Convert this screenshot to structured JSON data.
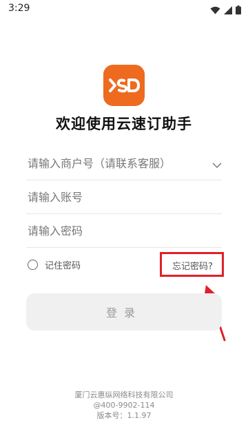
{
  "status_bar": {
    "time": "3:29",
    "icons": [
      "wifi-icon",
      "signal-icon",
      "battery-icon"
    ]
  },
  "app": {
    "logo_icon": "ysd-logo",
    "brand_color": "#ee6a1f",
    "welcome_title": "欢迎使用云速订助手"
  },
  "form": {
    "merchant_placeholder": "请输入商户号（请联系客服）",
    "account_placeholder": "请输入账号",
    "password_placeholder": "请输入密码",
    "remember_label": "记住密码",
    "forgot_label": "忘记密码?",
    "login_label": "登录"
  },
  "annotation": {
    "highlight_color": "#e0202a"
  },
  "footer": {
    "company": "厦门云惠纵网络科技有限公司",
    "phone": "@400-9902-114",
    "version": "版本号：1.1.97"
  }
}
